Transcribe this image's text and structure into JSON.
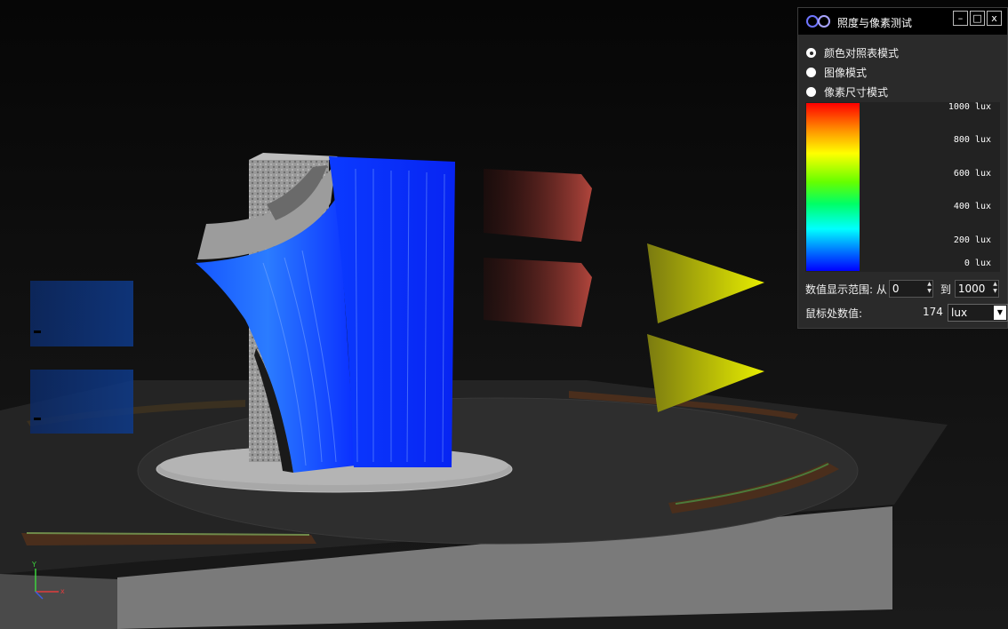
{
  "panel": {
    "title": "照度与像素测试",
    "window_buttons": {
      "minimize": "–",
      "maximize": "□",
      "close": "x"
    },
    "modes": [
      {
        "label": "颜色对照表模式",
        "checked": true
      },
      {
        "label": "图像模式",
        "checked": false
      },
      {
        "label": "像素尺寸模式",
        "checked": false
      }
    ],
    "legend_ticks": [
      "1000 lux",
      "800 lux",
      "600 lux",
      "400 lux",
      "200 lux",
      "0 lux"
    ],
    "range": {
      "label": "数值显示范围: 从",
      "from": "0",
      "to_label": "到",
      "to": "1000"
    },
    "mouse_value": {
      "label": "鼠标处数值:",
      "value": "174",
      "unit": "lux"
    }
  },
  "viewport": {
    "axis_labels": {
      "x": "x",
      "y": "Y"
    }
  },
  "colors": {
    "panel_bg": "#2a2a2a",
    "surface_blue": "#0a2cff",
    "projector_yellow": "#d8e000",
    "panel_red": "#7a2a24"
  }
}
